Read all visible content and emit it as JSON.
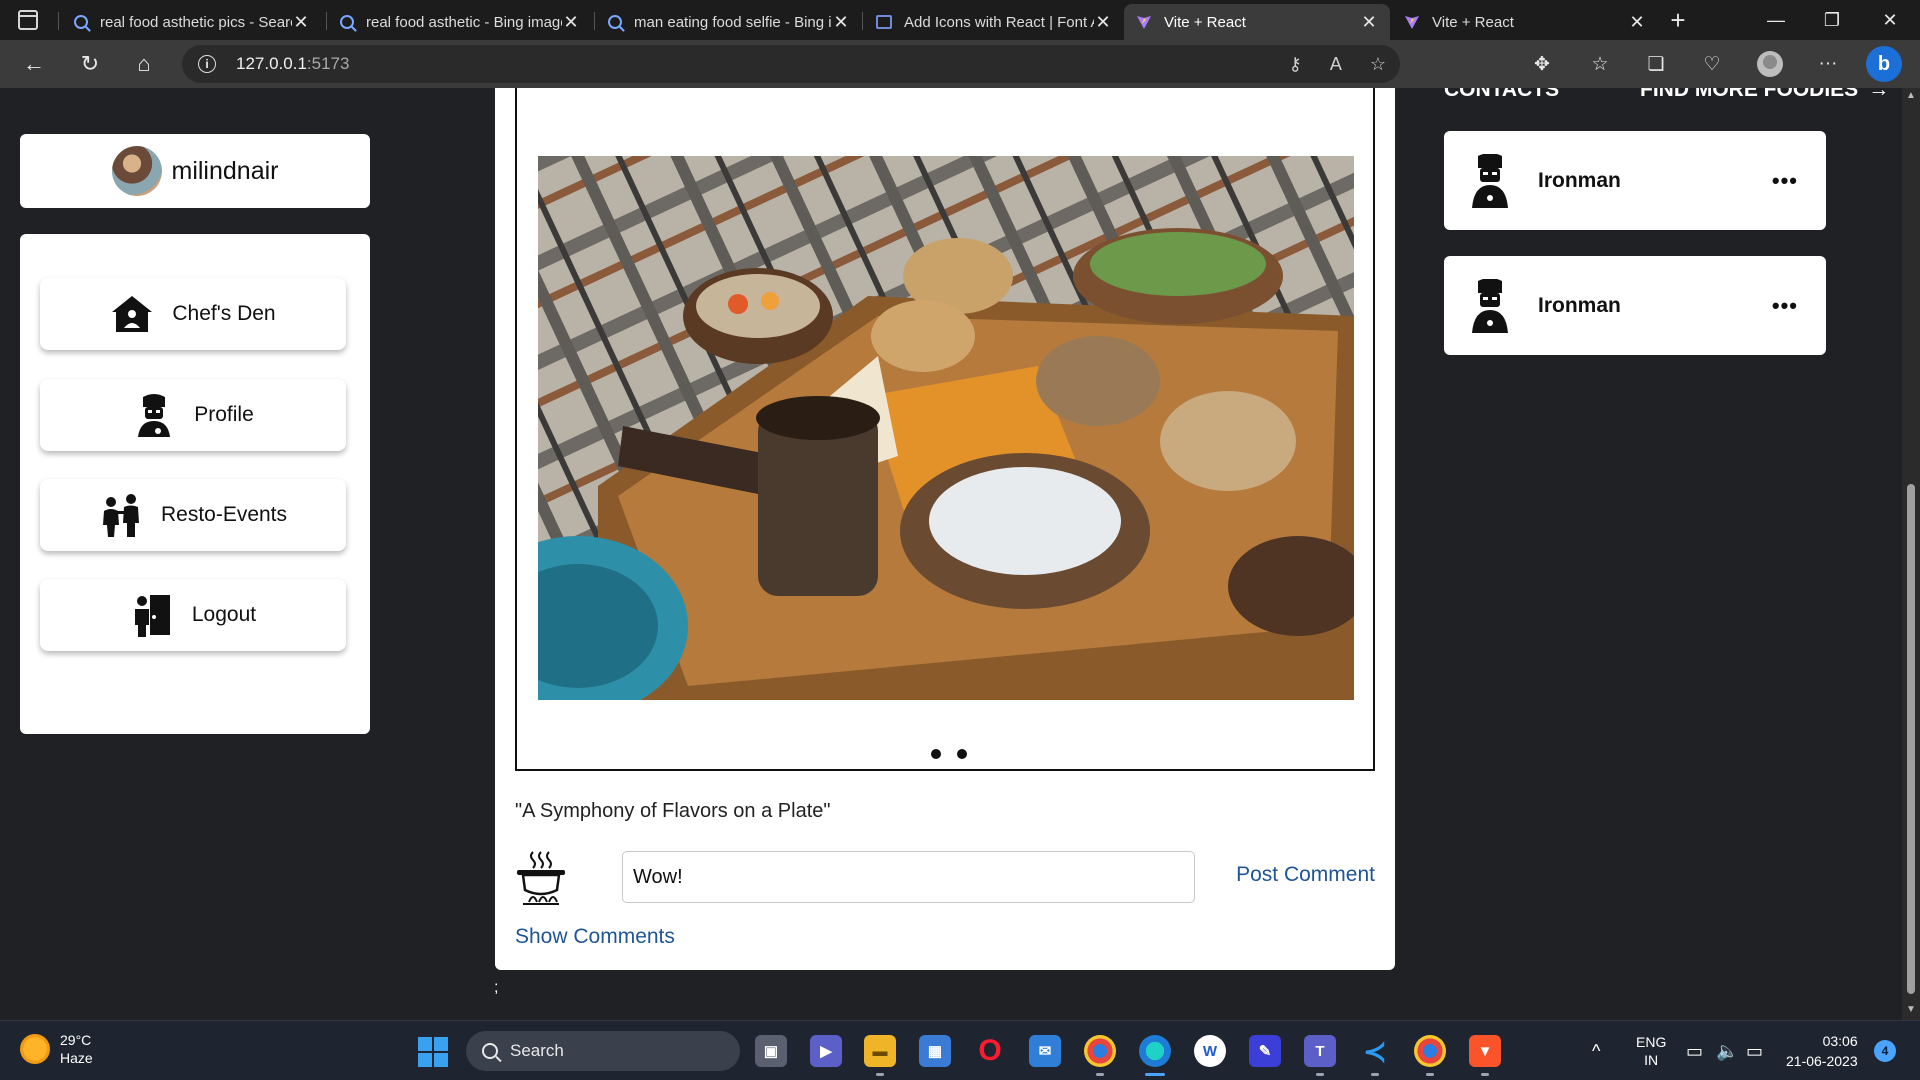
{
  "browser": {
    "tabs": [
      {
        "title": "real food asthetic pics - Search",
        "favicon": "search-icon",
        "active": false
      },
      {
        "title": "real food asthetic - Bing images",
        "favicon": "search-icon",
        "active": false
      },
      {
        "title": "man eating food selfie - Bing images",
        "favicon": "search-icon",
        "active": false
      },
      {
        "title": "Add Icons with React | Font Awesome",
        "favicon": "chat-icon",
        "active": false
      },
      {
        "title": "Vite + React",
        "favicon": "vite-icon",
        "active": true
      },
      {
        "title": "Vite + React",
        "favicon": "vite-icon",
        "active": false
      }
    ],
    "url_host": "127.0.0.1",
    "url_port": ":5173"
  },
  "sidebar": {
    "username": "milindnair",
    "menu": [
      {
        "label": "Chef's Den",
        "icon": "home-icon"
      },
      {
        "label": "Profile",
        "icon": "chef-icon"
      },
      {
        "label": "Resto-Events",
        "icon": "people-icon"
      },
      {
        "label": "Logout",
        "icon": "logout-door-icon"
      }
    ]
  },
  "post": {
    "caption": "\"A Symphony of Flavors on a Plate\"",
    "comment_value": "Wow!",
    "post_button": "Post Comment",
    "show_comments": "Show Comments",
    "carousel_dots": 2,
    "stray_text": ";"
  },
  "contacts": {
    "title": "CONTACTS",
    "find_more": "FIND MORE FOODIES",
    "list": [
      {
        "name": "Ironman",
        "more": "•••"
      },
      {
        "name": "Ironman",
        "more": "•••"
      }
    ]
  },
  "taskbar": {
    "weather_temp": "29°C",
    "weather_desc": "Haze",
    "search_label": "Search",
    "lang_top": "ENG",
    "lang_bottom": "IN",
    "time": "03:06",
    "date": "21-06-2023",
    "notifications": "4"
  },
  "colors": {
    "page_bg": "#202124",
    "card_bg": "#ffffff",
    "link": "#1f5596",
    "taskbar": "#1f2530"
  }
}
